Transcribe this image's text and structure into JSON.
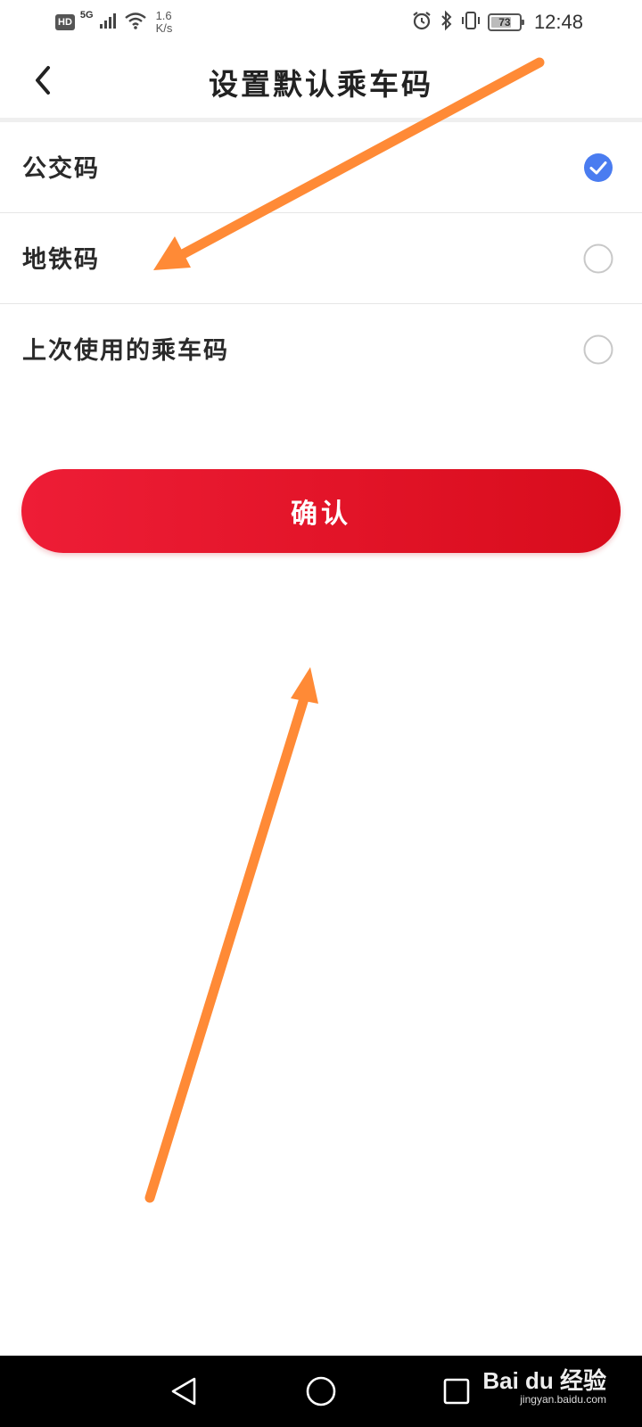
{
  "status_bar": {
    "hd": "HD",
    "network": "5G",
    "net_speed_value": "1.6",
    "net_speed_unit": "K/s",
    "battery_level": "73",
    "battery_fraction": 0.73,
    "time": "12:48",
    "icons": [
      "signal-icon",
      "wifi-icon",
      "alarm-icon",
      "bluetooth-icon",
      "vibrate-icon",
      "battery-icon"
    ]
  },
  "header": {
    "title": "设置默认乘车码",
    "back_icon": "chevron-left-icon"
  },
  "options": [
    {
      "label": "公交码",
      "selected": true
    },
    {
      "label": "地铁码",
      "selected": false
    },
    {
      "label": "上次使用的乘车码",
      "selected": false
    }
  ],
  "confirm_label": "确认",
  "watermark": {
    "brand": "Bai du 经验",
    "site": "jingyan.baidu.com"
  },
  "colors": {
    "check_blue": "#4a7cf0",
    "button_red_start": "#ee1d36",
    "button_red_end": "#d80c1c",
    "arrow_orange": "#ff8a36"
  }
}
